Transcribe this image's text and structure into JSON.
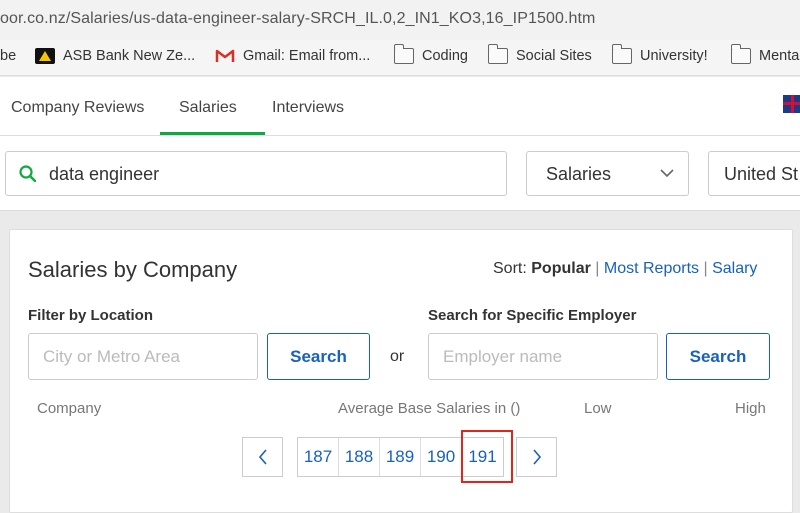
{
  "browser": {
    "url": "oor.co.nz/Salaries/us-data-engineer-salary-SRCH_IL.0,2_IN1_KO3,16_IP1500.htm",
    "bookmarks": [
      {
        "label": "be",
        "icon": "none"
      },
      {
        "label": "ASB Bank New Ze...",
        "icon": "asb-logo-icon"
      },
      {
        "label": "Gmail: Email from...",
        "icon": "gmail-icon"
      },
      {
        "label": "Coding",
        "icon": "folder-icon"
      },
      {
        "label": "Social Sites",
        "icon": "folder-icon"
      },
      {
        "label": "University!",
        "icon": "folder-icon"
      },
      {
        "label": "Menta",
        "icon": "folder-icon"
      }
    ]
  },
  "nav": {
    "tabs": [
      {
        "label": "Company Reviews",
        "active": false
      },
      {
        "label": "Salaries",
        "active": true
      },
      {
        "label": "Interviews",
        "active": false
      }
    ],
    "accent": "#0caa41"
  },
  "search": {
    "keyword": "data engineer",
    "type": "Salaries",
    "location": "United St"
  },
  "card": {
    "title": "Salaries by Company",
    "sort": {
      "prefix": "Sort:",
      "current": "Popular",
      "options": [
        "Most Reports",
        "Salary"
      ],
      "separator": "|"
    },
    "filter_location": {
      "label": "Filter by Location",
      "placeholder": "City or Metro Area",
      "button": "Search"
    },
    "or_text": "or",
    "employer_search": {
      "label": "Search for Specific Employer",
      "placeholder": "Employer name",
      "button": "Search"
    },
    "columns": [
      "Company",
      "Average Base Salaries in ()",
      "Low",
      "High"
    ],
    "pagination": {
      "pages": [
        "187",
        "188",
        "189",
        "190",
        "191"
      ],
      "current": "191",
      "link_color": "#1861bf"
    }
  }
}
